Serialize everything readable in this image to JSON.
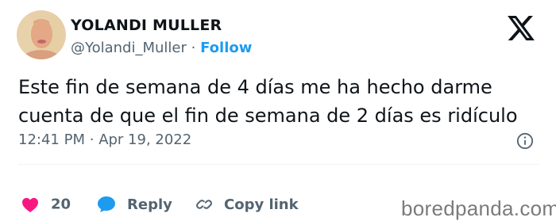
{
  "author": {
    "name": "YOLANDI MULLER",
    "handle": "@Yolandi_Muller",
    "separator": "·",
    "follow_label": "Follow"
  },
  "tweet": {
    "lines": [
      "Este fin de semana de 4 días me ha hecho darme",
      "cuenta de que el fin de semana de 2 días es ridículo"
    ],
    "time": "12:41 PM",
    "meta_separator": "·",
    "date": "Apr 19, 2022"
  },
  "actions": {
    "like_count": "20",
    "reply_label": "Reply",
    "copy_link_label": "Copy link"
  },
  "watermark": "boredpanda.com",
  "colors": {
    "accent": "#1d9bf0",
    "like": "#f91880",
    "text": "#0f1419",
    "muted": "#536471"
  },
  "icons": [
    "x-logo-icon",
    "info-icon",
    "heart-icon",
    "reply-bubble-icon",
    "link-icon"
  ]
}
